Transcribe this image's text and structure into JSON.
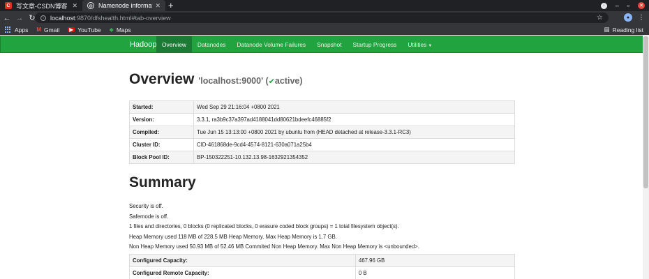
{
  "browser": {
    "tabs": [
      {
        "title": "写文章-CSDN博客",
        "favicon": "csdn-icon",
        "active": false
      },
      {
        "title": "Namenode information",
        "favicon": "globe-icon",
        "active": true
      }
    ],
    "url_host": "localhost",
    "url_path": ":9870/dfshealth.html#tab-overview",
    "bookmarks": [
      {
        "label": "Apps",
        "icon": "apps-grid-icon"
      },
      {
        "label": "Gmail",
        "icon": "gmail-icon"
      },
      {
        "label": "YouTube",
        "icon": "youtube-icon"
      },
      {
        "label": "Maps",
        "icon": "maps-icon"
      }
    ],
    "reading_list": "Reading list"
  },
  "navbar": {
    "brand": "Hadoop",
    "items": [
      "Overview",
      "Datanodes",
      "Datanode Volume Failures",
      "Snapshot",
      "Startup Progress",
      "Utilities"
    ],
    "active": "Overview"
  },
  "overview": {
    "title": "Overview",
    "host": "'localhost:9000'",
    "state_open": "(",
    "state": "active)",
    "rows": [
      {
        "key": "Started:",
        "value": "Wed Sep 29 21:16:04 +0800 2021"
      },
      {
        "key": "Version:",
        "value": "3.3.1, ra3b9c37a397ad4188041dd80621bdeefc46885f2"
      },
      {
        "key": "Compiled:",
        "value": "Tue Jun 15 13:13:00 +0800 2021 by ubuntu from (HEAD detached at release-3.3.1-RC3)"
      },
      {
        "key": "Cluster ID:",
        "value": "CID-461868de-9cd4-4574-8121-630a071a25b4"
      },
      {
        "key": "Block Pool ID:",
        "value": "BP-150322251-10.132.13.98-1632921354352"
      }
    ]
  },
  "summary": {
    "title": "Summary",
    "lines": [
      "Security is off.",
      "Safemode is off.",
      "1 files and directories, 0 blocks (0 replicated blocks, 0 erasure coded block groups) = 1 total filesystem object(s).",
      "Heap Memory used 118 MB of 228.5 MB Heap Memory. Max Heap Memory is 1.7 GB.",
      "Non Heap Memory used 50.93 MB of 52.46 MB Commited Non Heap Memory. Max Non Heap Memory is <unbounded>."
    ],
    "rows": [
      {
        "key": "Configured Capacity:",
        "value": "467.96 GB"
      },
      {
        "key": "Configured Remote Capacity:",
        "value": "0 B"
      }
    ]
  }
}
